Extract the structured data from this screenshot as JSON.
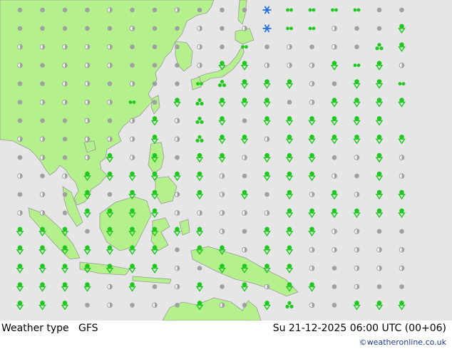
{
  "map": {
    "type": "weather-type-symbol-map",
    "region": "Western Pacific / Southeast Asia",
    "colors": {
      "ocean": "#e6e6e6",
      "land": "#b4f08c",
      "coast": "#9a9a9a",
      "rain": "#1ec81e",
      "cloud": "#a0a0a0",
      "snow": "#1e6ee6"
    }
  },
  "footer": {
    "label": "Weather type",
    "model": "GFS",
    "datetime": "Su 21-12-2025 06:00 UTC (00+06)",
    "credit": "©weatheronline.co.uk"
  }
}
